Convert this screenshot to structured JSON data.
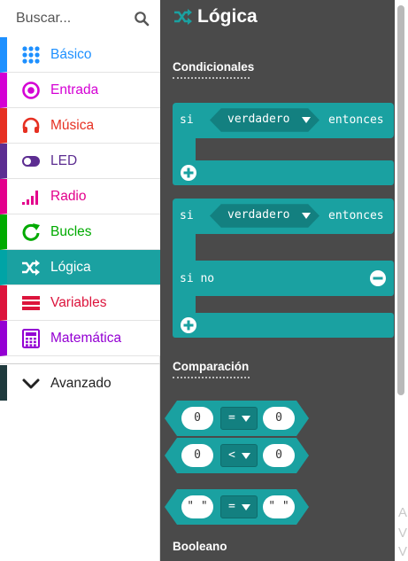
{
  "search": {
    "placeholder": "Buscar..."
  },
  "categories": [
    {
      "label": "Básico",
      "color": "#1e90ff",
      "icon": "grid-icon"
    },
    {
      "label": "Entrada",
      "color": "#d400d4",
      "icon": "target-icon"
    },
    {
      "label": "Música",
      "color": "#e63022",
      "icon": "headphones-icon"
    },
    {
      "label": "LED",
      "color": "#5c2d91",
      "icon": "toggle-icon"
    },
    {
      "label": "Radio",
      "color": "#e3008c",
      "icon": "signal-bars-icon"
    },
    {
      "label": "Bucles",
      "color": "#00aa00",
      "icon": "loop-arrow-icon"
    },
    {
      "label": "Lógica",
      "color": "#00a4a6",
      "icon": "shuffle-icon"
    },
    {
      "label": "Variables",
      "color": "#dc143c",
      "icon": "list-bars-icon"
    },
    {
      "label": "Matemática",
      "color": "#9400d3",
      "icon": "calculator-icon"
    }
  ],
  "selected_category": "Lógica",
  "advanced": {
    "label": "Avanzado",
    "icon": "chevron-down-icon"
  },
  "flyout": {
    "title": "Lógica",
    "sections": {
      "conditionals": "Condicionales",
      "comparison": "Comparación",
      "boolean": "Booleano"
    },
    "if_block": {
      "keyword_if": "si",
      "condition": "verdadero",
      "keyword_then": "entonces"
    },
    "if_else_block": {
      "keyword_if": "si",
      "condition": "verdadero",
      "keyword_then": "entonces",
      "keyword_else": "si no"
    },
    "compare_blocks": [
      {
        "left": "0",
        "operator": "=",
        "right": "0"
      },
      {
        "left": "0",
        "operator": "<",
        "right": "0"
      },
      {
        "left": "\" \"",
        "operator": "=",
        "right": "\" \""
      }
    ]
  },
  "colors": {
    "logic_block": "#1aa1a1",
    "logic_block_dark": "#138080",
    "flyout_background": "#4a4a4a",
    "selected_category_bg": "#1aa1a1"
  },
  "edge_text": [
    "A",
    "V",
    "V"
  ]
}
